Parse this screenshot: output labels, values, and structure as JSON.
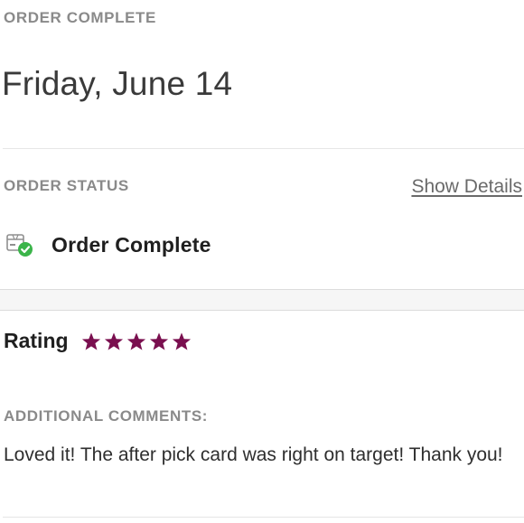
{
  "header": {
    "section_label": "ORDER COMPLETE",
    "date": "Friday, June 14"
  },
  "status": {
    "section_label": "ORDER STATUS",
    "show_details": "Show Details",
    "icon": "package-check-icon",
    "text": "Order Complete"
  },
  "rating": {
    "label": "Rating",
    "value": 5,
    "max": 5,
    "star_color": "#7a0f4f"
  },
  "comments": {
    "section_label": "ADDITIONAL COMMENTS:",
    "text": "Loved it! The after pick card was right on target! Thank you!"
  },
  "colors": {
    "label_gray": "#8a8a8a",
    "check_green": "#3bb44a"
  }
}
